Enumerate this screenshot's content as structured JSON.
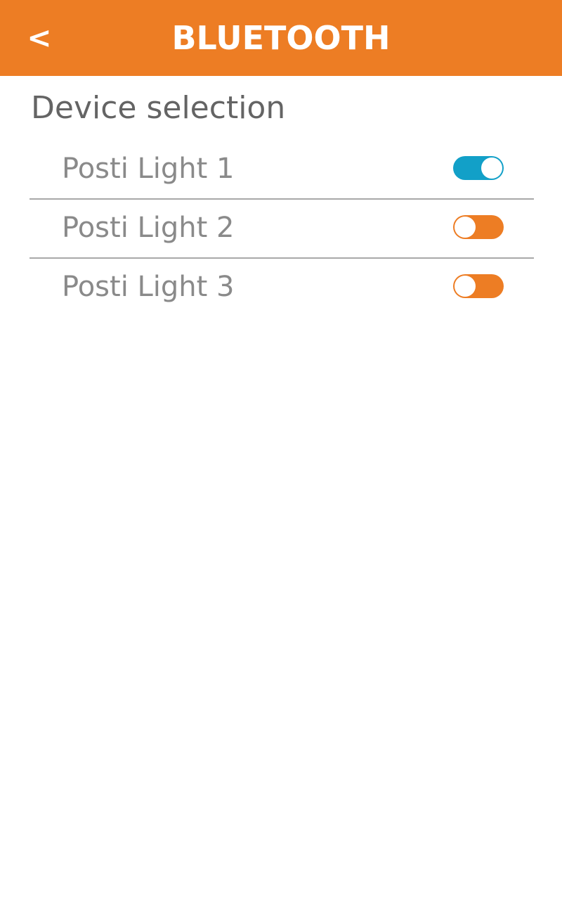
{
  "header": {
    "back_label": "<",
    "title": "BLUETOOTH",
    "background_color": "#ED7D24"
  },
  "section": {
    "title": "Device selection"
  },
  "devices": [
    {
      "label": "Posti Light 1",
      "enabled": true,
      "toggle_color": "#12A0C8"
    },
    {
      "label": "Posti Light 2",
      "enabled": false,
      "toggle_color": "#ED7D24"
    },
    {
      "label": "Posti Light 3",
      "enabled": false,
      "toggle_color": "#ED7D24"
    }
  ]
}
